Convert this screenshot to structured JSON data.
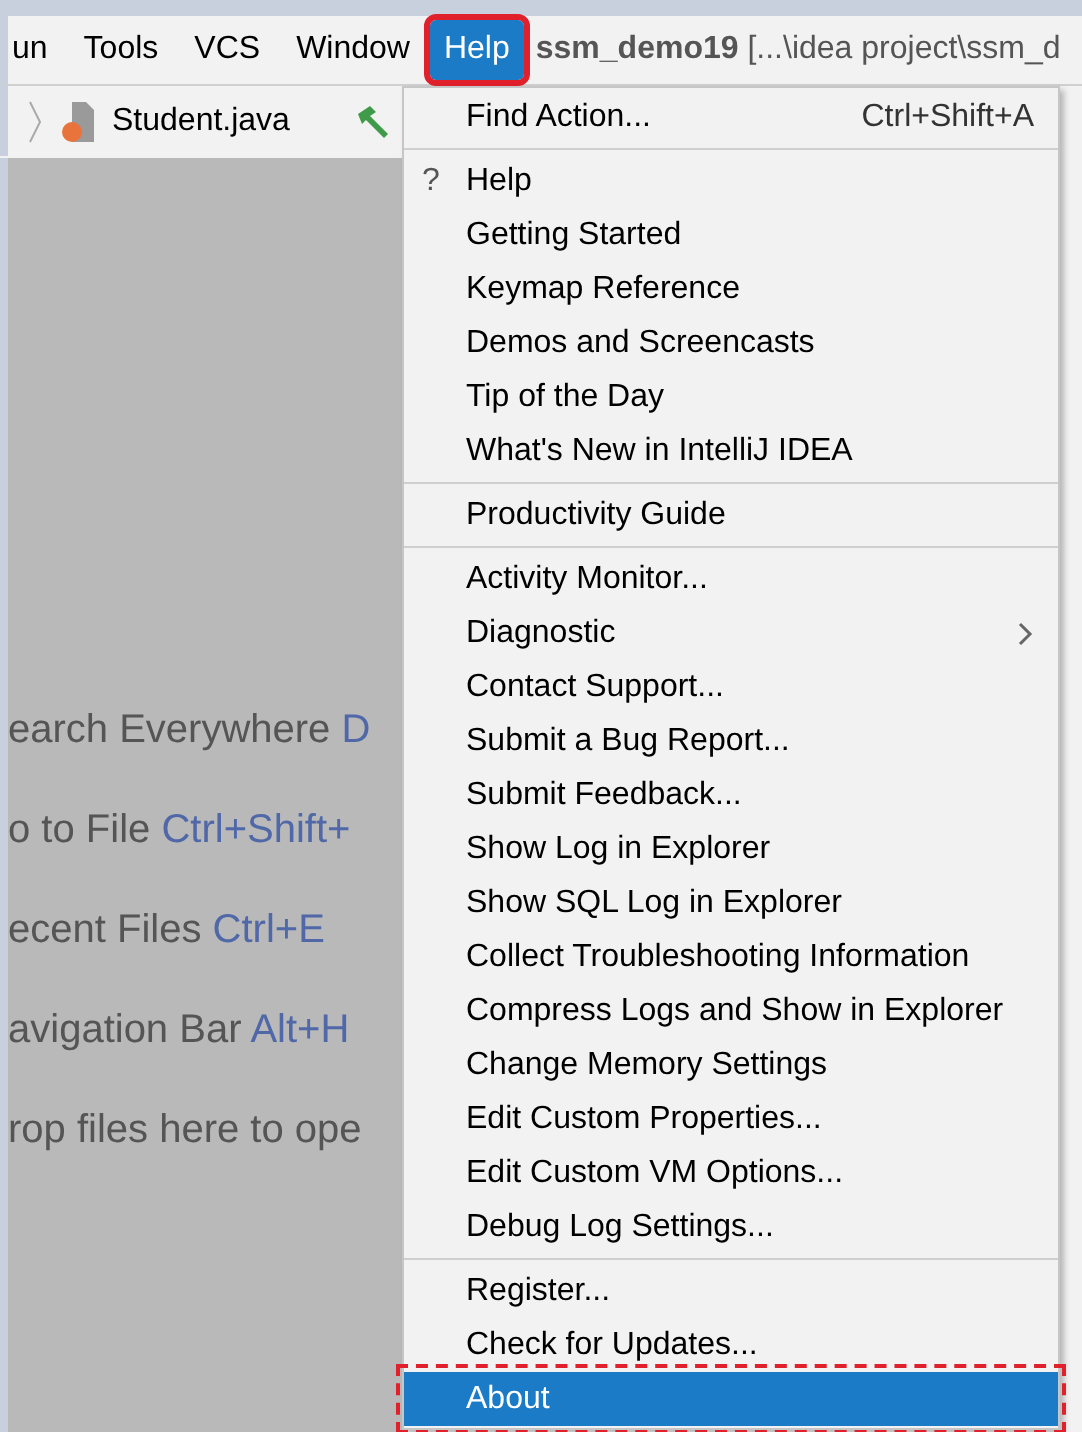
{
  "menu_bar": {
    "items": [
      {
        "label": "un",
        "selected": false
      },
      {
        "label": "Tools",
        "selected": false
      },
      {
        "label": "VCS",
        "selected": false
      },
      {
        "label": "Window",
        "selected": false
      },
      {
        "label": "Help",
        "selected": true
      }
    ],
    "project_title": "ssm_demo19",
    "project_path": "[...\\idea project\\ssm_d"
  },
  "nav_bar": {
    "file": "Student.java"
  },
  "editor_hints": [
    {
      "text": "earch Everywhere",
      "shortcut": "D"
    },
    {
      "text": "o to File",
      "shortcut": "Ctrl+Shift+"
    },
    {
      "text": "ecent Files",
      "shortcut": "Ctrl+E"
    },
    {
      "text": "avigation Bar",
      "shortcut": "Alt+H"
    },
    {
      "text": "rop files here to ope"
    }
  ],
  "help_menu": {
    "sections": [
      [
        {
          "label": "Find Action...",
          "shortcut": "Ctrl+Shift+A",
          "kind": "action",
          "selected": false
        }
      ],
      [
        {
          "label": "Help",
          "icon": "?",
          "kind": "action",
          "selected": false
        },
        {
          "label": "Getting Started",
          "kind": "action",
          "selected": false
        },
        {
          "label": "Keymap Reference",
          "kind": "action",
          "selected": false
        },
        {
          "label": "Demos and Screencasts",
          "kind": "action",
          "selected": false
        },
        {
          "label": "Tip of the Day",
          "kind": "action",
          "selected": false
        },
        {
          "label": "What's New in IntelliJ IDEA",
          "kind": "action",
          "selected": false
        }
      ],
      [
        {
          "label": "Productivity Guide",
          "kind": "action",
          "selected": false
        }
      ],
      [
        {
          "label": "Activity Monitor...",
          "kind": "action",
          "selected": false
        },
        {
          "label": "Diagnostic",
          "kind": "submenu",
          "selected": false
        },
        {
          "label": "Contact Support...",
          "kind": "action",
          "selected": false
        },
        {
          "label": "Submit a Bug Report...",
          "kind": "action",
          "selected": false
        },
        {
          "label": "Submit Feedback...",
          "kind": "action",
          "selected": false
        },
        {
          "label": "Show Log in Explorer",
          "kind": "action",
          "selected": false
        },
        {
          "label": "Show SQL Log in Explorer",
          "kind": "action",
          "selected": false
        },
        {
          "label": "Collect Troubleshooting Information",
          "kind": "action",
          "selected": false
        },
        {
          "label": "Compress Logs and Show in Explorer",
          "kind": "action",
          "selected": false
        },
        {
          "label": "Change Memory Settings",
          "kind": "action",
          "selected": false
        },
        {
          "label": "Edit Custom Properties...",
          "kind": "action",
          "selected": false
        },
        {
          "label": "Edit Custom VM Options...",
          "kind": "action",
          "selected": false
        },
        {
          "label": "Debug Log Settings...",
          "kind": "action",
          "selected": false
        }
      ],
      [
        {
          "label": "Register...",
          "kind": "action",
          "selected": false
        },
        {
          "label": "Check for Updates...",
          "kind": "action",
          "selected": false
        },
        {
          "label": "About",
          "kind": "action",
          "selected": true
        }
      ]
    ]
  }
}
